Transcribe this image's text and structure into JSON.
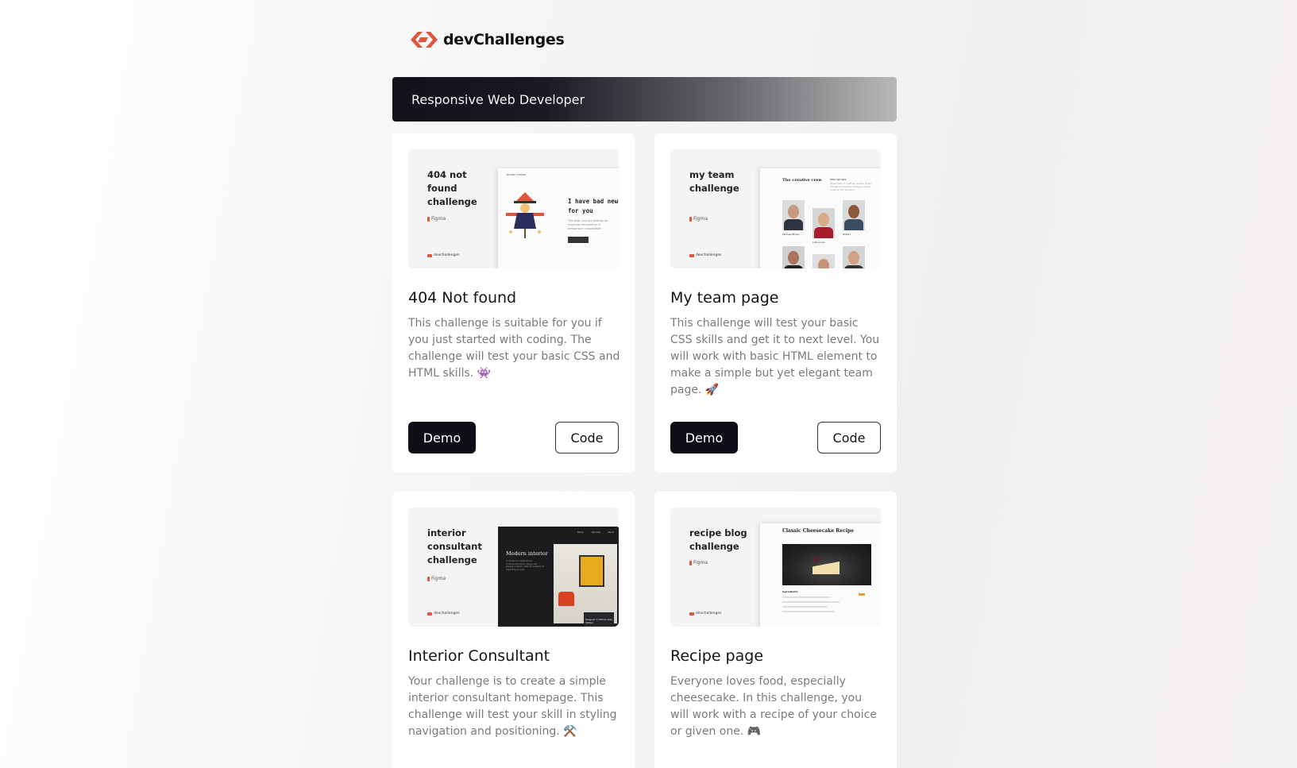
{
  "header": {
    "logo_text": "devChallenges",
    "brand_color": "#e0553d"
  },
  "banner": {
    "title": "Responsive Web Developer"
  },
  "cards": [
    {
      "thumb_title": "404 not found challenge",
      "thumb_figma": "Figma",
      "thumb_brand": "devchallenges",
      "shot_topline": "404 NOT FOUND",
      "shot_headline_1": "I have bad news",
      "shot_headline_2": "for you",
      "shot_text": "The page you are looking for might be removed or is temporarily unavailable",
      "shot_button": "BACK TO HOMEPAGE",
      "title": "404 Not found",
      "description": "This challenge is suitable for you if you just started with coding. The challenge will test your basic CSS and HTML skills. 👾",
      "demo_label": "Demo",
      "code_label": "Code"
    },
    {
      "thumb_title": "my team challenge",
      "thumb_figma": "Figma",
      "thumb_brand": "devchallenges",
      "shot_heading": "The creative crew",
      "shot_subheading": "WHO WE ARE",
      "shot_text": "We are team of creatively diverse, driven, innovative individuals working in various locations from the world.",
      "member_names": [
        "Michael Brown",
        "Julie Jones",
        "Robert"
      ],
      "title": "My team page",
      "description": "This challenge will test your basic CSS skills and get it to next level. You will work with basic HTML element to make a simple but yet elegant team page. 🚀",
      "demo_label": "Demo",
      "code_label": "Code"
    },
    {
      "thumb_title": "interior consultant challenge",
      "thumb_figma": "Figma",
      "thumb_brand": "devchallenges",
      "shot_nav": [
        "Home",
        "Services",
        "About"
      ],
      "shot_heading": "Modern interior",
      "shot_text": "A full-Service residential & commercial interior design and staging company offering professional organizing & more.",
      "shot_caption": "Designed in 2024 by Aliza Webber",
      "title": "Interior Consultant",
      "description": "Your challenge is to create a simple interior consultant homepage. This challenge will test your skill in styling navigation and positioning. ⚒️"
    },
    {
      "thumb_title": "recipe blog challenge",
      "thumb_figma": "Figma",
      "thumb_brand": "devchallenges",
      "shot_heading": "Classic Cheesecake Recipe",
      "shot_section": "Ingredients",
      "title": "Recipe page",
      "description": "Everyone loves food, especially cheesecake. In this challenge, you will work with a recipe of your choice or given one. 🎮"
    }
  ]
}
